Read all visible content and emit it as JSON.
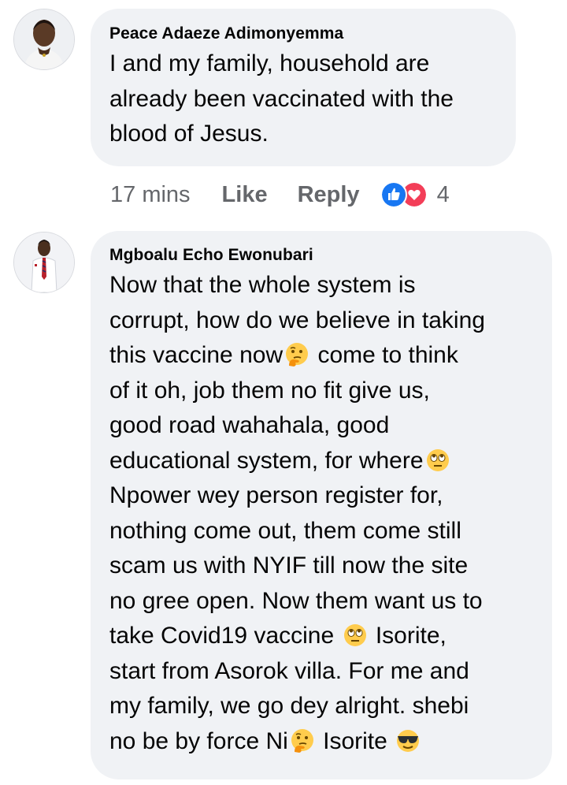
{
  "comments": [
    {
      "author": "Peace Adaeze Adimonyemma",
      "text_lines": [
        "I and my family, household are",
        "already been vaccinated with the",
        "blood of Jesus."
      ],
      "time": "17 mins",
      "like_label": "Like",
      "reply_label": "Reply",
      "reactions": [
        "like-reaction-icon",
        "love-reaction-icon"
      ],
      "reaction_count": "4"
    },
    {
      "author": "Mgboalu Echo Ewonubari",
      "text_segments": {
        "l1": "Now that the whole system is",
        "l2": "corrupt, how do we believe in taking",
        "l3a": "this vaccine now",
        "l3b": " come to think",
        "l4": "of it oh, job them no fit give us,",
        "l5": "good road wahahala, good",
        "l6a": "educational system, for where",
        "l7": "Npower wey person register for,",
        "l8": "nothing come out, them come still",
        "l9": "scam us with NYIF till now the site",
        "l10": "no gree open. Now them want us to",
        "l11a": "take Covid19 vaccine ",
        "l11b": " Isorite,",
        "l12": "start from Asorok villa. For me and",
        "l13": "my family, we go dey alright. shebi",
        "l14a": "no be by force Ni",
        "l14b": " Isorite "
      },
      "emojis": [
        "thinking-face",
        "eye-roll-face",
        "eye-roll-face",
        "thinking-face",
        "sunglasses-face"
      ]
    }
  ],
  "colors": {
    "bubble": "#f0f2f5",
    "meta_text": "#65676b",
    "text": "#050505",
    "like_blue": "#1877f2",
    "love_red": "#f33e58"
  }
}
